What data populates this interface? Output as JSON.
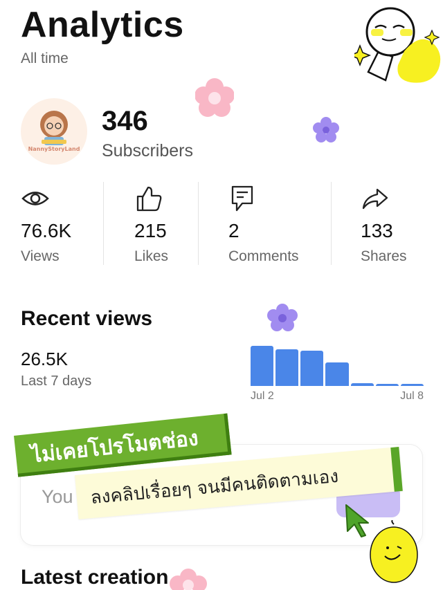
{
  "header": {
    "title": "Analytics",
    "subtitle": "All time"
  },
  "profile": {
    "avatar_brand": "NannyStoryLand",
    "subscribers_count": "346",
    "subscribers_label": "Subscribers"
  },
  "stats": [
    {
      "icon": "eye-icon",
      "value": "76.6K",
      "label": "Views"
    },
    {
      "icon": "thumbs-up-icon",
      "value": "215",
      "label": "Likes"
    },
    {
      "icon": "comment-icon",
      "value": "2",
      "label": "Comments"
    },
    {
      "icon": "share-arrow-icon",
      "value": "133",
      "label": "Shares"
    }
  ],
  "recent_views": {
    "title": "Recent views",
    "value": "26.5K",
    "range": "Last 7 days"
  },
  "chart_data": {
    "type": "bar",
    "categories": [
      "Jul 2",
      "",
      "",
      "",
      "",
      "",
      "Jul 8"
    ],
    "x_tick_labels": [
      "Jul 2",
      "Jul 8"
    ],
    "values": [
      1.0,
      0.92,
      0.88,
      0.58,
      0.07,
      0.06,
      0.06
    ],
    "value_units": "relative (fraction of tallest bar; no y-axis shown)",
    "bar_color": "#4a86e8"
  },
  "promo_card": {
    "text_fragment": "You"
  },
  "overlay": {
    "banner_green_text": "ไม่เคยโปรโมตช่อง",
    "banner_yellow_text": "ลงคลิปเรื่อยๆ จนมีคนติดตามเอง"
  },
  "latest": {
    "title": "Latest creation"
  },
  "colors": {
    "accent_blue": "#4a86e8",
    "banner_green": "#6db02e",
    "banner_yellow": "#fdfbd8",
    "sticker_yellow": "#f7f021",
    "flower_pink": "#f9b7c6",
    "flower_purple": "#a18cf0"
  }
}
